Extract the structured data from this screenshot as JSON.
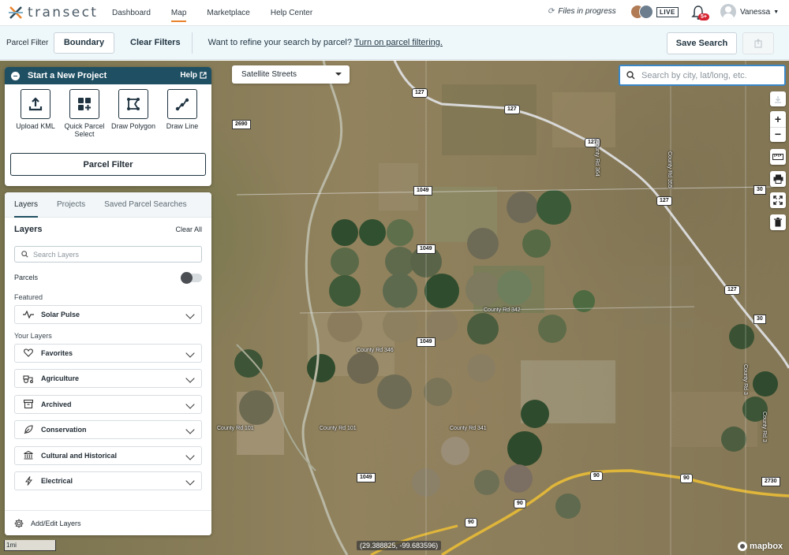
{
  "app": {
    "brand": "transect"
  },
  "nav": {
    "links": [
      "Dashboard",
      "Map",
      "Marketplace",
      "Help Center"
    ],
    "active": "Map",
    "files_status": "Files in progress",
    "live_label": "LIVE",
    "notification_count": "5+",
    "user_name": "Vanessa"
  },
  "filter_bar": {
    "label": "Parcel Filter",
    "boundary_button": "Boundary",
    "clear_filters": "Clear Filters",
    "refine_text": "Want to refine your search by parcel?",
    "refine_link": "Turn on parcel filtering.",
    "save_search": "Save Search"
  },
  "project_panel": {
    "title": "Start a New Project",
    "help": "Help",
    "tools": [
      {
        "label": "Upload KML",
        "icon": "upload-icon"
      },
      {
        "label": "Quick Parcel Select",
        "icon": "quick-parcel-icon"
      },
      {
        "label": "Draw Polygon",
        "icon": "polygon-icon"
      },
      {
        "label": "Draw Line",
        "icon": "line-icon"
      }
    ],
    "parcel_filter_button": "Parcel Filter"
  },
  "layers_panel": {
    "tabs": [
      "Layers",
      "Projects",
      "Saved Parcel Searches"
    ],
    "active_tab": "Layers",
    "title": "Layers",
    "clear_all": "Clear All",
    "search_placeholder": "Search Layers",
    "parcels_label": "Parcels",
    "parcels_enabled": false,
    "featured_label": "Featured",
    "featured": [
      {
        "label": "Solar Pulse",
        "icon": "pulse-icon"
      }
    ],
    "your_layers_label": "Your Layers",
    "your_layers": [
      {
        "label": "Favorites",
        "icon": "heart-icon"
      },
      {
        "label": "Agriculture",
        "icon": "tractor-icon"
      },
      {
        "label": "Archived",
        "icon": "archive-icon"
      },
      {
        "label": "Conservation",
        "icon": "leaf-icon"
      },
      {
        "label": "Cultural and Historical",
        "icon": "landmark-icon"
      },
      {
        "label": "Electrical",
        "icon": "bolt-icon"
      }
    ],
    "footer": "Add/Edit Layers"
  },
  "map": {
    "style_select": "Satellite Streets",
    "search_placeholder": "Search by city, lat/long, etc.",
    "scale": "1mi",
    "coordinates": "(29.388825, -99.683596)",
    "attribution": "mapbox",
    "shields": [
      "127",
      "127",
      "127",
      "127",
      "127",
      "2690",
      "1049",
      "1049",
      "1049",
      "1049",
      "30",
      "30",
      "90",
      "90",
      "90",
      "90",
      "2730"
    ],
    "road_labels": [
      "County Rd 364",
      "County Rd 355",
      "County Rd 342",
      "County Rd 346",
      "County Rd 101",
      "County Rd 101",
      "County Rd 341",
      "County Rd 3",
      "County Rd 3"
    ]
  },
  "colors": {
    "accent": "#e8822b",
    "header": "#1f4f62",
    "badge": "#d5212e",
    "search_border": "#3a87c8",
    "highway": "#e0b63a"
  }
}
